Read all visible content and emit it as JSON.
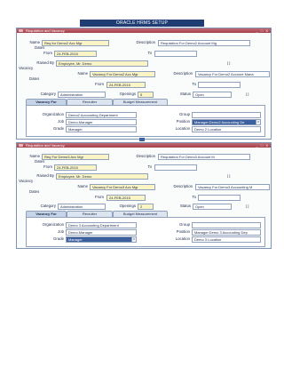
{
  "doc_title": "ORACLE HRMS SETUP",
  "window_title": "Requisition and Vacancy",
  "window_controls": "_ □ X",
  "labels": {
    "name": "Name",
    "dates": "Dates",
    "from": "From",
    "to": "To",
    "raised_by": "Raised By",
    "description": "Description",
    "vacancy": "Vacancy",
    "category": "Category",
    "openings": "Openings",
    "status": "Status",
    "organization": "Organization",
    "job": "Job",
    "grade": "Grade",
    "group": "Group",
    "position": "Position",
    "location": "Location"
  },
  "tabs": [
    "Vacancy For",
    "Recruiter",
    "Budget Measurement"
  ],
  "forms": [
    {
      "req_name": "Req for Demo2 Acc Mgr",
      "req_description": "Requisition For Demo2 Account Mg",
      "req_from": "24-FEB-2015",
      "req_to": "",
      "raised_by": "Employee, Mr. Demo",
      "bracket": "[  ]",
      "vac_name": "Vacancy For Demo2 Acc Mgr",
      "vac_description": "Vacancy For Demo2 Account Mana",
      "vac_from": "24-FEB-2015",
      "vac_to": "",
      "category": "Administration",
      "openings": "5",
      "status": "Open",
      "organization": "Demo2 Accounting Department",
      "job": "Demo.Manager",
      "grade": "Manager",
      "group": "",
      "position": "Manager.Demo2 Accounting De",
      "location": "Demo 2 Location"
    },
    {
      "req_name": "Req For Demo3 Acc Mgr",
      "req_description": "Requisition For Demo3 Account M",
      "req_from": "24-FEB-2015",
      "req_to": "",
      "raised_by": "Employee, Mr. Demo",
      "bracket": "[  ]",
      "vac_name": "Vacancy For Demo3 Acc Mgr",
      "vac_description": "Vacancy For Demo3 Accounting M",
      "vac_from": "24-FEB-2015",
      "vac_to": "",
      "category": "Administration",
      "openings": "2",
      "status": "Open",
      "organization": "Demo 3 Accounting Department",
      "job": "Demo.Manager",
      "grade": "Manager",
      "group": "",
      "position": "Manager.Demo 3 Accounting Dep",
      "location": "Demo 3 Location"
    }
  ],
  "colors": {
    "title_bar": "#a13f4b",
    "doc_title_bg": "#1f3d73",
    "required_field": "#fbf5c6",
    "selected_field": "#3c5f9e"
  }
}
